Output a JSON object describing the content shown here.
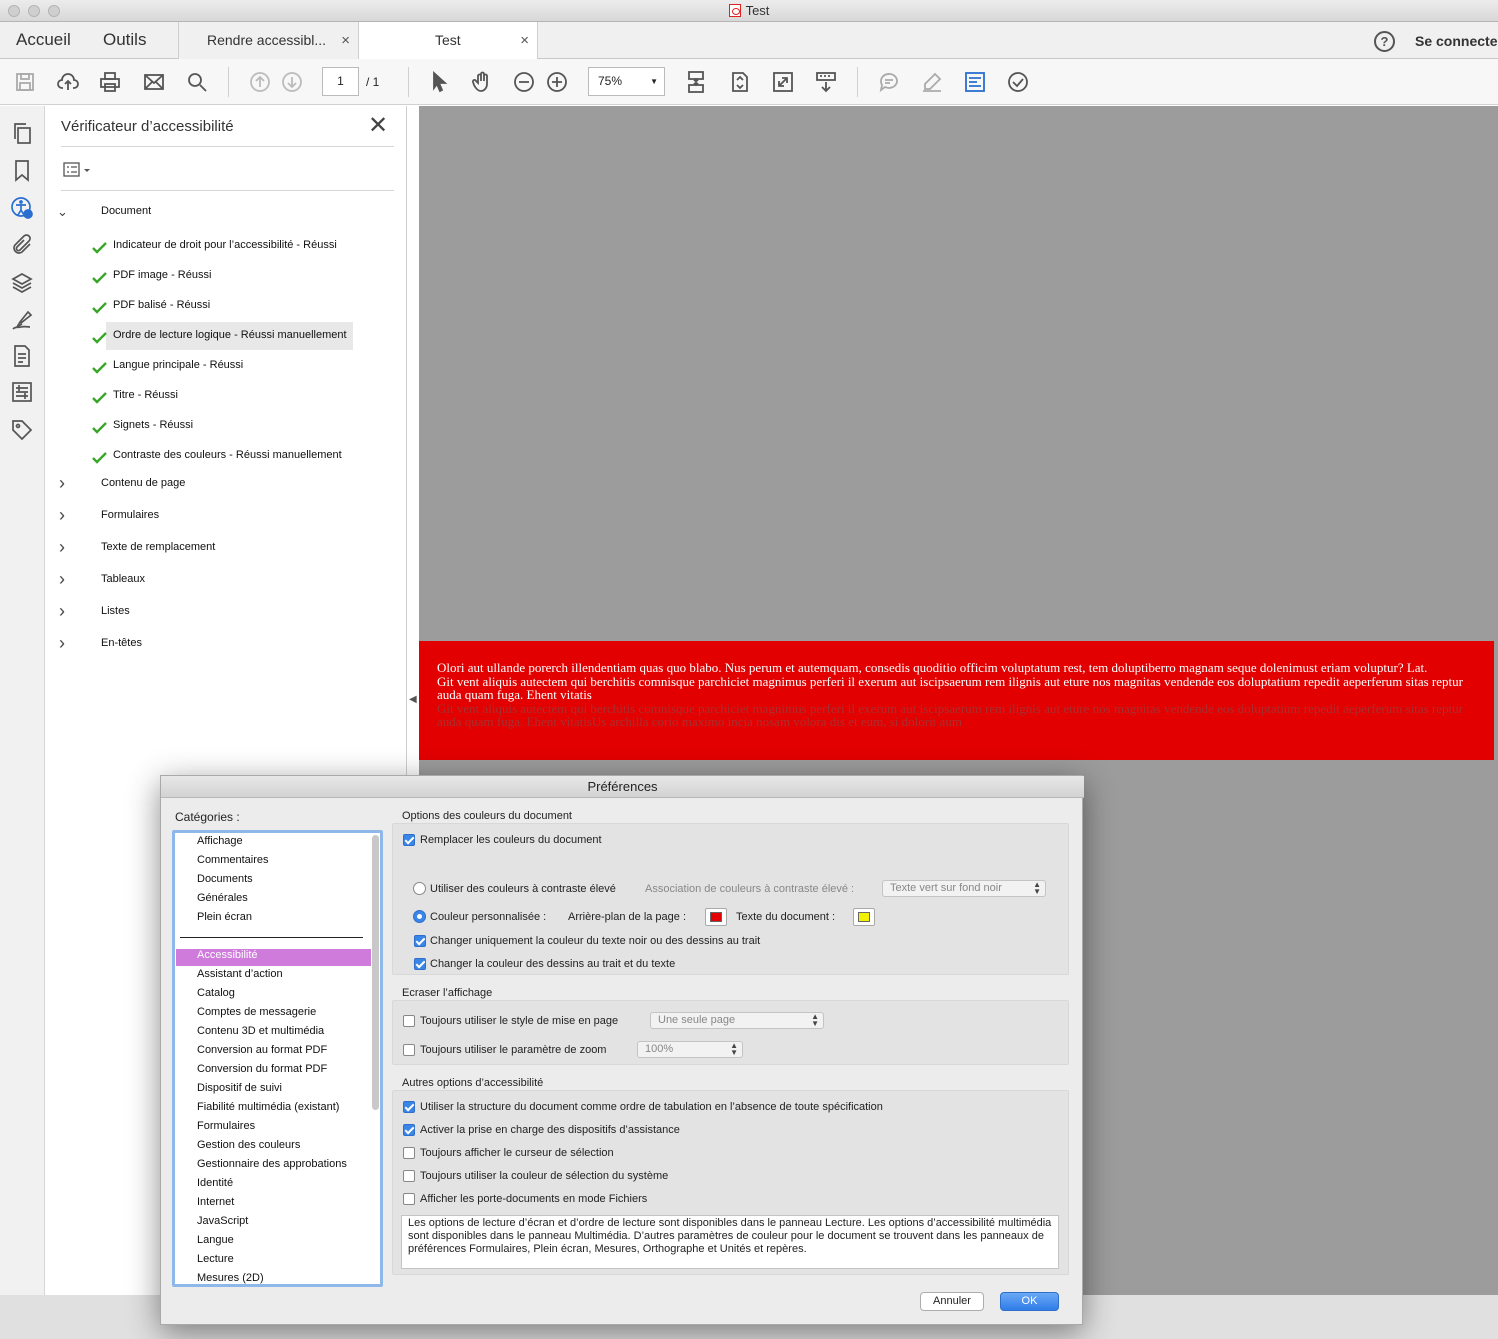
{
  "window": {
    "title": "Test"
  },
  "tabs": {
    "home": "Accueil",
    "tools": "Outils",
    "doc1": "Rendre accessibl...",
    "doc2": "Test",
    "close": "×",
    "help": "?",
    "signin": "Se connecter"
  },
  "toolbar": {
    "page_current": "1",
    "page_total": "/ 1",
    "zoom": "75%"
  },
  "panel": {
    "title": "Vérificateur d’accessibilité",
    "root": "Document",
    "checks": [
      "Indicateur de droit pour l’accessibilité - Réussi",
      "PDF image - Réussi",
      "PDF balisé - Réussi",
      "Ordre de lecture logique - Réussi manuellement",
      "Langue principale - Réussi",
      "Titre - Réussi",
      "Signets - Réussi",
      "Contraste des couleurs - Réussi manuellement"
    ],
    "groups": [
      "Contenu de page",
      "Formulaires",
      "Texte de remplacement",
      "Tableaux",
      "Listes",
      "En-têtes"
    ]
  },
  "document": {
    "line1": "Olori aut ullande porerch illendentiam quas quo blabo. Nus perum et autemquam, consedis quoditio officim voluptatum rest, tem doluptiberro magnam seque dolenimust eriam voluptur? Lat.",
    "line2": "Git vent aliquis autectem qui berchitis comnisque parchiciet magnimus perferi il exerum aut iscipsaerum rem ilignis aut eture nos magnitas vendende eos doluptatium repedit aeperferum sitas reptur auda quam fuga. Ehent vitatis",
    "line3": "Git vent aliquis autectem qui berchitis comnisque parchiciet magnimus perferi il exerum aut iscipsaerum rem ilignis aut eture nos magnitas vendende eos doluptatium repedit aeperferum sitas reptur auda quam fuga. Ehent vitatisUs archilla corio maximo incia nosam volora dis et eum, si dolorit aum",
    "background_color": "#e20000"
  },
  "dialog": {
    "title": "Préférences",
    "categories_label": "Catégories :",
    "categories_top": [
      "Affichage",
      "Commentaires",
      "Documents",
      "Générales",
      "Plein écran"
    ],
    "categories": [
      "Accessibilité",
      "Assistant d’action",
      "Catalog",
      "Comptes de messagerie",
      "Contenu 3D et multimédia",
      "Conversion au format PDF",
      "Conversion du format PDF",
      "Dispositif de suivi",
      "Fiabilité multimédia (existant)",
      "Formulaires",
      "Gestion des couleurs",
      "Gestionnaire des approbations",
      "Identité",
      "Internet",
      "JavaScript",
      "Langue",
      "Lecture",
      "Mesures (2D)"
    ],
    "selected_category": "Accessibilité",
    "color_section": "Options des couleurs du document",
    "replace_colors": "Remplacer les couleurs du document",
    "high_contrast": "Utiliser des couleurs à contraste élevé",
    "assoc_label": "Association de couleurs à contraste élevé :",
    "assoc_value": "Texte vert sur fond noir",
    "custom_color": "Couleur personnalisée :",
    "page_bg": "Arrière-plan de la page :",
    "page_bg_color": "#e20000",
    "doc_text": "Texte du document :",
    "doc_text_color": "#f2f200",
    "only_black": "Changer uniquement la couleur du texte noir ou des dessins au trait",
    "line_art": "Changer la couleur des dessins au trait et du texte",
    "override_section": "Ecraser l’affichage",
    "always_layout": "Toujours utiliser le style de mise en page",
    "layout_value": "Une seule page",
    "always_zoom": "Toujours utiliser le paramètre de zoom",
    "zoom_value": "100%",
    "other_section": "Autres options d’accessibilité",
    "opt_tab": "Utiliser la structure du document comme ordre de tabulation en l’absence de toute spécification",
    "opt_assist": "Activer la prise en charge des dispositifs d’assistance",
    "opt_cursor": "Toujours afficher le curseur de sélection",
    "opt_syscolor": "Toujours utiliser la couleur de sélection du système",
    "opt_portfolio": "Afficher les porte-documents en mode Fichiers",
    "info": "Les options de lecture d’écran et d’ordre de lecture sont disponibles dans le panneau Lecture. Les options d’accessibilité multimédia sont disponibles dans le panneau Multimédia. D’autres paramètres de couleur pour le document se trouvent dans les panneaux de préférences Formulaires, Plein écran, Mesures, Orthographe et Unités et repères.",
    "cancel": "Annuler",
    "ok": "OK"
  }
}
